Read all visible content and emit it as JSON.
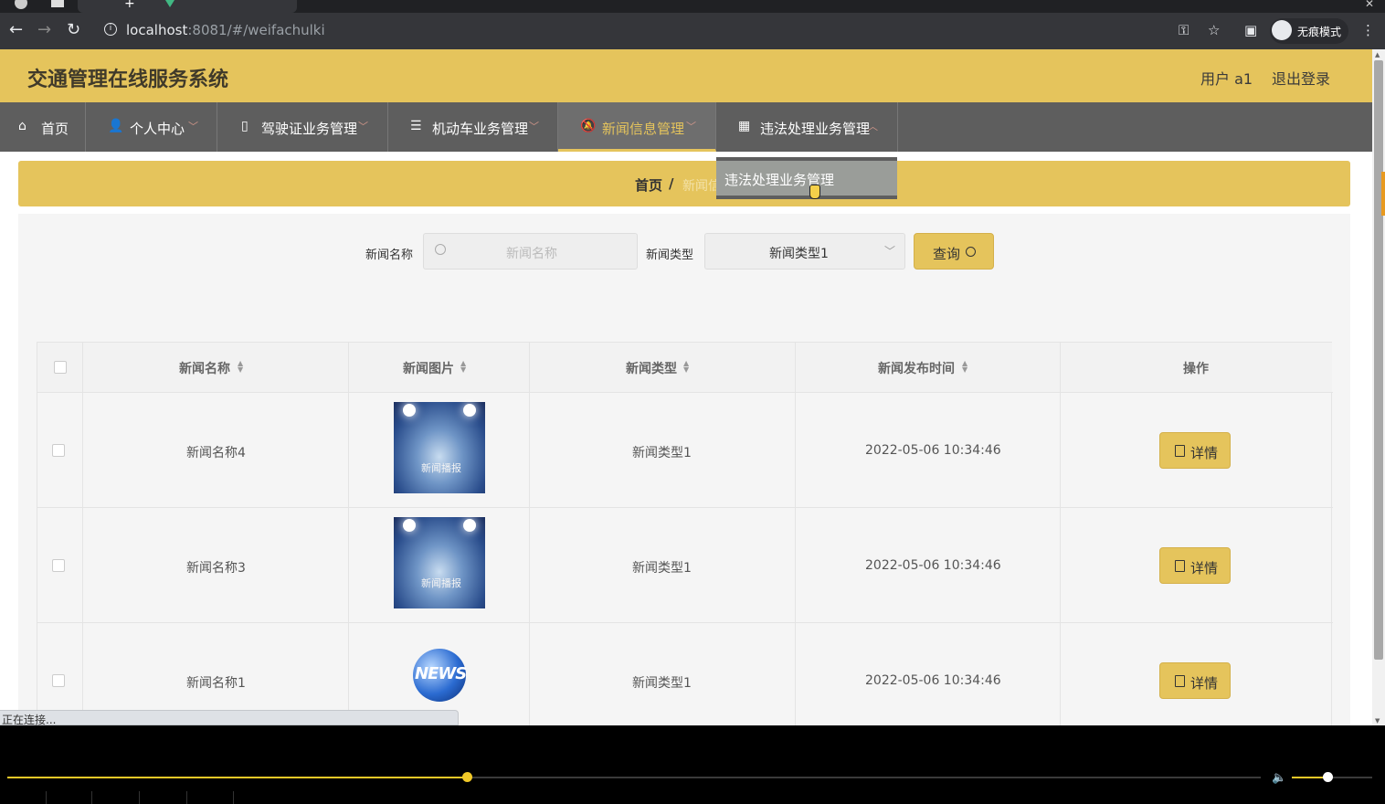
{
  "browser": {
    "url_host": "localhost",
    "url_rest": ":8081/#/weifachulki",
    "incognito_label": "无痕模式"
  },
  "header": {
    "title": "交通管理在线服务系统",
    "user": "用户 a1",
    "logout": "退出登录"
  },
  "menu": [
    {
      "label": "首页",
      "icon": "home-icon"
    },
    {
      "label": "个人中心",
      "icon": "user-icon"
    },
    {
      "label": "驾驶证业务管理",
      "icon": "card-icon"
    },
    {
      "label": "机动车业务管理",
      "icon": "list-icon"
    },
    {
      "label": "新闻信息管理",
      "icon": "bell-icon"
    },
    {
      "label": "违法处理业务管理",
      "icon": "grid-icon"
    }
  ],
  "dropdown": {
    "item": "违法处理业务管理"
  },
  "breadcrumb": {
    "home": "首页",
    "sep": "/",
    "current": "新闻信"
  },
  "search": {
    "name_label": "新闻名称",
    "name_placeholder": "新闻名称",
    "type_label": "新闻类型",
    "type_value": "新闻类型1",
    "query_label": "查询"
  },
  "table": {
    "headers": [
      "新闻名称",
      "新闻图片",
      "新闻类型",
      "新闻发布时间",
      "操作"
    ],
    "rows": [
      {
        "name": "新闻名称4",
        "image": "spotlight",
        "type": "新闻类型1",
        "time": "2022-05-06 10:34:46",
        "action": "详情"
      },
      {
        "name": "新闻名称3",
        "image": "spotlight",
        "type": "新闻类型1",
        "time": "2022-05-06 10:34:46",
        "action": "详情"
      },
      {
        "name": "新闻名称1",
        "image": "globe",
        "type": "新闻类型1",
        "time": "2022-05-06 10:34:46",
        "action": "详情"
      }
    ],
    "image_caption": "新闻播报",
    "globe_text": "NEWS"
  },
  "status_text": "正在连接...",
  "player": {
    "progress": 0.37,
    "volume": 0.45
  },
  "colors": {
    "accent": "#e5c45c",
    "menu_bg": "#5e5e5e"
  }
}
